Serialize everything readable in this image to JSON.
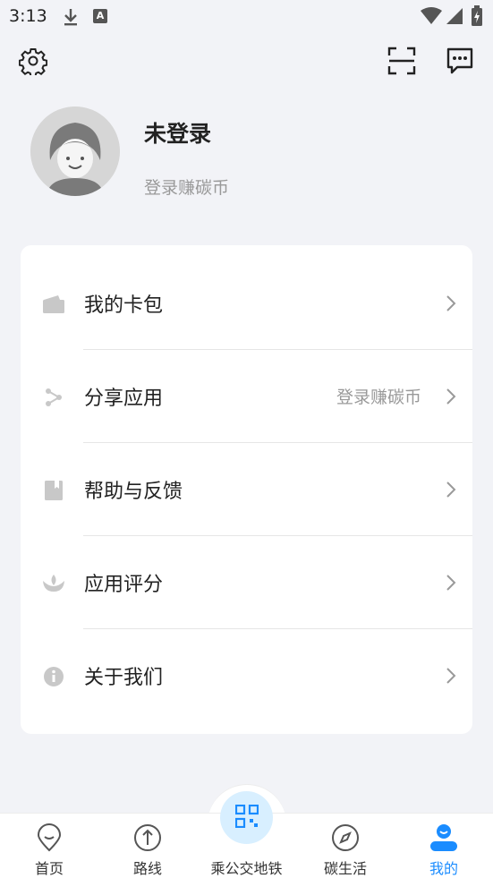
{
  "status_bar": {
    "time": "3:13",
    "a_badge": "A"
  },
  "header": {
    "icons": [
      "gear-icon",
      "scan-icon",
      "message-icon"
    ]
  },
  "profile": {
    "name": "未登录",
    "subtitle": "登录赚碳币"
  },
  "menu": {
    "items": [
      {
        "label": "我的卡包",
        "extra": "",
        "icon": "wallet-icon"
      },
      {
        "label": "分享应用",
        "extra": "登录赚碳币",
        "icon": "share-icon"
      },
      {
        "label": "帮助与反馈",
        "extra": "",
        "icon": "book-icon"
      },
      {
        "label": "应用评分",
        "extra": "",
        "icon": "lotus-icon"
      },
      {
        "label": "关于我们",
        "extra": "",
        "icon": "info-icon"
      }
    ]
  },
  "bottom_nav": {
    "items": [
      {
        "label": "首页",
        "icon": "location-pin-icon"
      },
      {
        "label": "路线",
        "icon": "route-arrow-icon"
      },
      {
        "label": "乘公交地铁",
        "icon": "qr-code-icon"
      },
      {
        "label": "碳生活",
        "icon": "compass-icon"
      },
      {
        "label": "我的",
        "icon": "user-icon",
        "active": true
      }
    ],
    "active_color": "#1a8cff"
  }
}
